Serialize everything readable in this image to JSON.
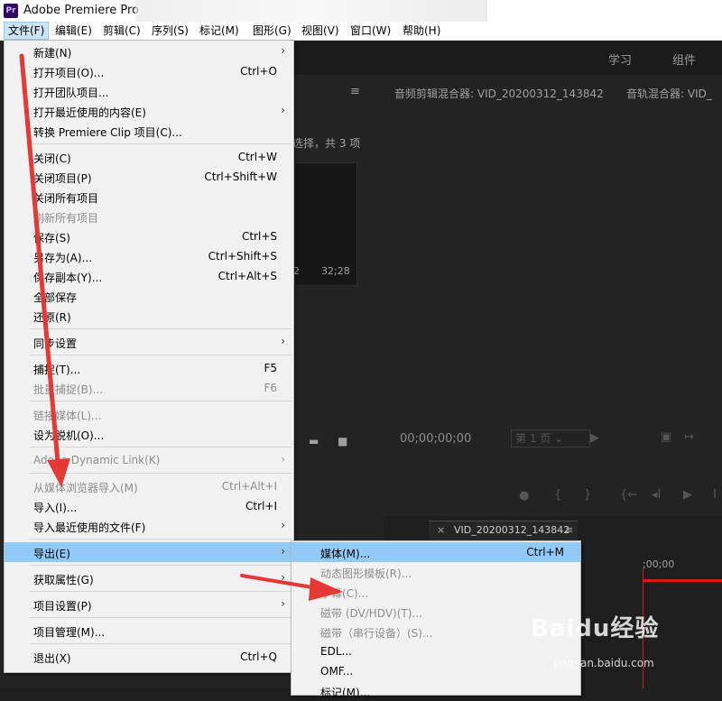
{
  "window": {
    "title": "Adobe Premiere Pro",
    "app_icon": "Pr"
  },
  "menubar": [
    {
      "label": "文件(F)"
    },
    {
      "label": "编辑(E)"
    },
    {
      "label": "剪辑(C)"
    },
    {
      "label": "序列(S)"
    },
    {
      "label": "标记(M)"
    },
    {
      "label": "图形(G)"
    },
    {
      "label": "视图(V)"
    },
    {
      "label": "窗口(W)"
    },
    {
      "label": "帮助(H)"
    }
  ],
  "workspace_tabs": {
    "learn": "学习",
    "assembly": "组件"
  },
  "project_panel": {
    "selection_info": "选择，共 3 项",
    "thumb_duration": "32;28",
    "thumb_partial": "2"
  },
  "audio_mixer": {
    "title": "音频剪辑混合器: VID_20200312_143842",
    "track_mixer": "音轨混合器: VID_"
  },
  "source": {
    "timecode": "00;00;00;00",
    "page_label": "第 1 页"
  },
  "timeline": {
    "sequence_tab": "VID_20200312_143842",
    "ruler_time": ";00;00"
  },
  "file_menu": {
    "items": [
      {
        "label": "新建(N)",
        "submenu": true
      },
      {
        "label": "打开项目(O)...",
        "shortcut": "Ctrl+O"
      },
      {
        "label": "打开团队项目..."
      },
      {
        "label": "打开最近使用的内容(E)",
        "submenu": true
      },
      {
        "label": "转换 Premiere Clip 项目(C)..."
      },
      {
        "label": "关闭(C)",
        "shortcut": "Ctrl+W"
      },
      {
        "label": "关闭项目(P)",
        "shortcut": "Ctrl+Shift+W"
      },
      {
        "label": "关闭所有项目"
      },
      {
        "label": "刷新所有项目",
        "disabled": true
      },
      {
        "label": "保存(S)",
        "shortcut": "Ctrl+S"
      },
      {
        "label": "另存为(A)...",
        "shortcut": "Ctrl+Shift+S"
      },
      {
        "label": "保存副本(Y)...",
        "shortcut": "Ctrl+Alt+S"
      },
      {
        "label": "全部保存"
      },
      {
        "label": "还原(R)"
      },
      {
        "label": "同步设置",
        "submenu": true
      },
      {
        "label": "捕捉(T)...",
        "shortcut": "F5"
      },
      {
        "label": "批量捕捉(B)...",
        "shortcut": "F6",
        "disabled": true
      },
      {
        "label": "链接媒体(L)...",
        "disabled": true
      },
      {
        "label": "设为脱机(O)..."
      },
      {
        "label": "Adobe Dynamic Link(K)",
        "submenu": true,
        "disabled": true
      },
      {
        "label": "从媒体浏览器导入(M)",
        "shortcut": "Ctrl+Alt+I",
        "disabled": true
      },
      {
        "label": "导入(I)...",
        "shortcut": "Ctrl+I"
      },
      {
        "label": "导入最近使用的文件(F)",
        "submenu": true
      },
      {
        "label": "导出(E)",
        "submenu": true,
        "highlighted": true
      },
      {
        "label": "获取属性(G)",
        "submenu": true
      },
      {
        "label": "项目设置(P)",
        "submenu": true
      },
      {
        "label": "项目管理(M)..."
      },
      {
        "label": "退出(X)",
        "shortcut": "Ctrl+Q"
      }
    ]
  },
  "export_submenu": {
    "items": [
      {
        "label": "媒体(M)...",
        "shortcut": "Ctrl+M",
        "highlighted": true
      },
      {
        "label": "动态图形模板(R)...",
        "disabled": true
      },
      {
        "label": "字幕(C)...",
        "disabled": true
      },
      {
        "label": "磁带 (DV/HDV)(T)...",
        "disabled": true
      },
      {
        "label": "磁带（串行设备）(S)...",
        "disabled": true
      },
      {
        "label": "EDL..."
      },
      {
        "label": "OMF..."
      },
      {
        "label": "标记(M)..."
      }
    ]
  },
  "watermark": {
    "brand": "Baidu经验",
    "url": "jingyan.baidu.com"
  },
  "colors": {
    "menu_bg": "#f2f2f2",
    "highlight": "#91c9f7",
    "arrow": "#e53935",
    "app_bg": "#232323"
  }
}
